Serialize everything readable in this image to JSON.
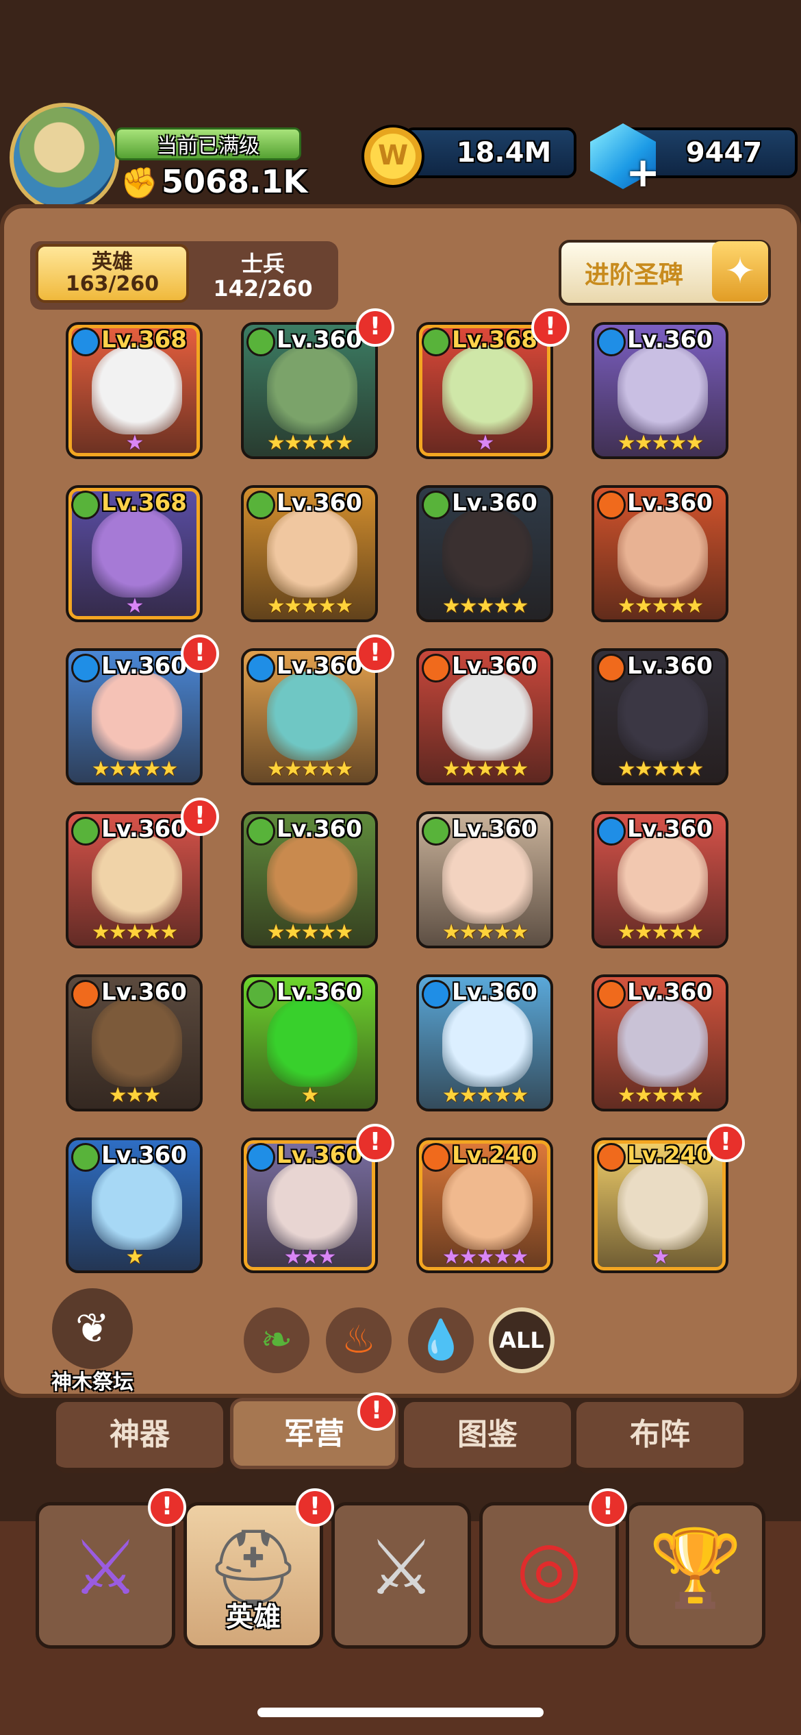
{
  "player": {
    "level_status": "当前已满级",
    "power": "5068.1K"
  },
  "resources": {
    "gold": "18.4M",
    "gems": "9447"
  },
  "tabs": {
    "heroes_label": "英雄",
    "heroes_count": "163/260",
    "soldiers_label": "士兵",
    "soldiers_count": "142/260"
  },
  "advance_button": "进阶圣碑",
  "heroes": [
    {
      "level": "Lv.368",
      "element": "water",
      "rank": "purple",
      "stars": "★",
      "alert": false
    },
    {
      "level": "Lv.360",
      "element": "leaf",
      "rank": "gold",
      "stars": "★★★★★",
      "alert": true
    },
    {
      "level": "Lv.368",
      "element": "leaf",
      "rank": "purple",
      "stars": "★",
      "alert": true
    },
    {
      "level": "Lv.360",
      "element": "water",
      "rank": "gold",
      "stars": "★★★★★",
      "alert": false
    },
    {
      "level": "Lv.368",
      "element": "leaf",
      "rank": "purple",
      "stars": "★",
      "alert": false
    },
    {
      "level": "Lv.360",
      "element": "leaf",
      "rank": "gold",
      "stars": "★★★★★",
      "alert": false
    },
    {
      "level": "Lv.360",
      "element": "leaf",
      "rank": "gold",
      "stars": "★★★★★",
      "alert": false
    },
    {
      "level": "Lv.360",
      "element": "fire",
      "rank": "gold",
      "stars": "★★★★★",
      "alert": false
    },
    {
      "level": "Lv.360",
      "element": "water",
      "rank": "gold",
      "stars": "★★★★★",
      "alert": true
    },
    {
      "level": "Lv.360",
      "element": "water",
      "rank": "gold",
      "stars": "★★★★★",
      "alert": true
    },
    {
      "level": "Lv.360",
      "element": "fire",
      "rank": "gold",
      "stars": "★★★★★",
      "alert": false
    },
    {
      "level": "Lv.360",
      "element": "fire",
      "rank": "gold",
      "stars": "★★★★★",
      "alert": false
    },
    {
      "level": "Lv.360",
      "element": "leaf",
      "rank": "gold",
      "stars": "★★★★★",
      "alert": true
    },
    {
      "level": "Lv.360",
      "element": "leaf",
      "rank": "gold",
      "stars": "★★★★★",
      "alert": false
    },
    {
      "level": "Lv.360",
      "element": "leaf",
      "rank": "gold",
      "stars": "★★★★★",
      "alert": false
    },
    {
      "level": "Lv.360",
      "element": "water",
      "rank": "gold",
      "stars": "★★★★★",
      "alert": false
    },
    {
      "level": "Lv.360",
      "element": "fire",
      "rank": "gold",
      "stars": "★★★",
      "alert": false
    },
    {
      "level": "Lv.360",
      "element": "leaf",
      "rank": "gold",
      "stars": "★",
      "alert": false
    },
    {
      "level": "Lv.360",
      "element": "water",
      "rank": "gold",
      "stars": "★★★★★",
      "alert": false
    },
    {
      "level": "Lv.360",
      "element": "fire",
      "rank": "gold",
      "stars": "★★★★★",
      "alert": false
    },
    {
      "level": "Lv.360",
      "element": "leaf",
      "rank": "gold",
      "stars": "★",
      "alert": false
    },
    {
      "level": "Lv.360",
      "element": "water",
      "rank": "purple",
      "stars": "★★★",
      "alert": true
    },
    {
      "level": "Lv.240",
      "element": "fire",
      "rank": "purple",
      "stars": "★★★★★",
      "alert": false
    },
    {
      "level": "Lv.240",
      "element": "fire",
      "rank": "purple",
      "stars": "★",
      "alert": true
    }
  ],
  "altar_label": "神木祭坛",
  "filters": {
    "all_label": "ALL"
  },
  "subtabs": [
    "神器",
    "军营",
    "图鉴",
    "布阵"
  ],
  "nav": {
    "heroes_label": "英雄"
  },
  "element_colors": {
    "leaf": "#58b33a",
    "fire": "#f06a1c",
    "water": "#1f8ee6"
  }
}
